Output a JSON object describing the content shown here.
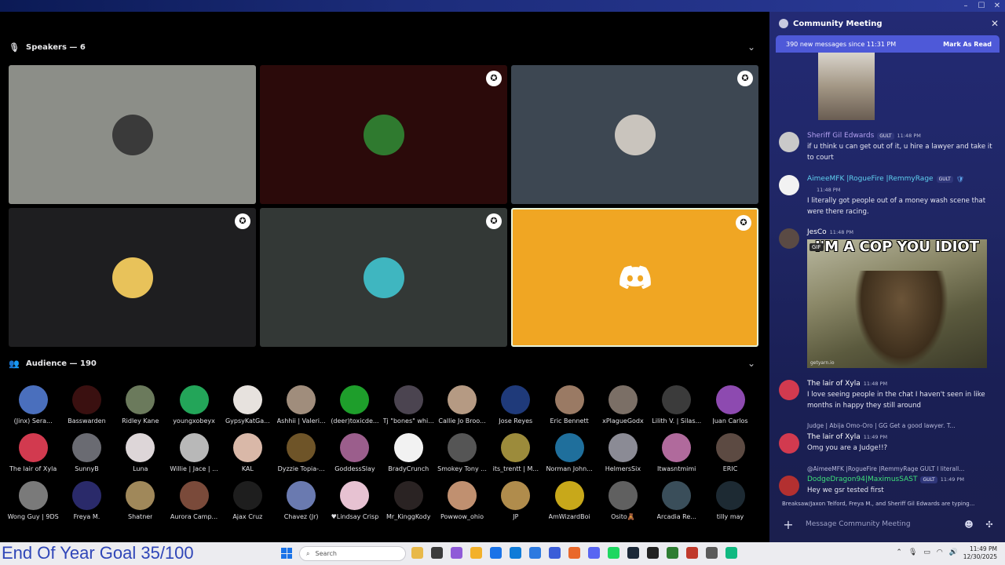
{
  "window": {
    "controls": [
      "–",
      "☐",
      "✕"
    ]
  },
  "stage": {
    "speakers_header": "Speakers — 6",
    "audience_header": "Audience — 190",
    "speakers": [
      {
        "name": "speaker-1",
        "bg": "#8c8e88",
        "avatar": "#3a3a3a",
        "moderator": false
      },
      {
        "name": "speaker-2",
        "bg": "#2b0a0a",
        "avatar": "#2f7a2f",
        "moderator": true
      },
      {
        "name": "speaker-3",
        "bg": "#3d4752",
        "avatar": "#c9c4bd",
        "moderator": true
      },
      {
        "name": "speaker-4",
        "bg": "#1e1e20",
        "avatar": "#e8c25a",
        "moderator": true
      },
      {
        "name": "speaker-5",
        "bg": "#333836",
        "avatar": "#3fb6c0",
        "moderator": true
      },
      {
        "name": "speaker-6",
        "bg": "#f0a623",
        "avatar": "",
        "moderator": true,
        "discord_logo": true
      }
    ],
    "audience": [
      [
        "(Jinx) Sera...",
        "Basswarden",
        "Ridley Kane",
        "youngxobeyx",
        "GypsyKatGa...",
        "Ashhii | Valeri...",
        "(deer)toxicde...",
        "Tj \"bones\" whi...",
        "Callie Jo Broo...",
        "Jose Reyes",
        "Eric Bennett",
        "xPlagueGodx",
        "Lilith V. | Silas...",
        "Juan Carlos"
      ],
      [
        "The lair of Xyla",
        "SunnyB",
        "Luna",
        "Willie | Jace | ...",
        "KAL",
        "Dyzzie Topia-...",
        "GoddessSlay",
        "BradyCrunch",
        "Smokey Tony ...",
        "its_trentt | M...",
        "Norman John...",
        "HelmersSix",
        "Itwasntmimi",
        "ERIC"
      ],
      [
        "Wong Guy | 9DS",
        "Freya M.",
        "Shatner",
        "Aurora Camp...",
        "Ajax Cruz",
        "Chavez (Jr)",
        "♥Lindsay Crisp",
        "Mr_KinggKody",
        "Powwow_ohio",
        "JP",
        "AmWizardBoi",
        "Osito🧸",
        "Arcadia Re...",
        "tilly may"
      ]
    ],
    "audience_colors": [
      [
        "#4a6fbd",
        "#3a1010",
        "#6b7a5c",
        "#23a559",
        "#e7e2de",
        "#a08d7c",
        "#1e9e2b",
        "#4b4450",
        "#b59a83",
        "#1f3a7a",
        "#9a7a64",
        "#7b6f66",
        "#3b3b3b",
        "#8d4ab0"
      ],
      [
        "#d23a4f",
        "#6a6b72",
        "#ddd6d8",
        "#b8b8b8",
        "#d9b8a8",
        "#6e5428",
        "#9b5e8c",
        "#f2f2f2",
        "#555555",
        "#9c8b3b",
        "#1f6f9c",
        "#8b8b95",
        "#b06a9c",
        "#5c4a42"
      ],
      [
        "#7a7a7a",
        "#2a2a6a",
        "#a0885a",
        "#7a4a3a",
        "#1e1e1e",
        "#6a7ab0",
        "#e7c2d2",
        "#2a2323",
        "#c09070",
        "#b08c4c",
        "#c8a81a",
        "#606060",
        "#3a4e5a",
        "#1d2a33"
      ]
    ]
  },
  "chat": {
    "title": "Community Meeting",
    "new_messages": "390 new messages since 11:31 PM",
    "mark_as_read": "Mark As Read",
    "messages": [
      {
        "author": "Sheriff Gil Edwards",
        "author_color": "#b2a0f0",
        "tag": "GULT",
        "time": "11:48 PM",
        "text": "if u think u can get out of it, u hire a lawyer and take it to court"
      },
      {
        "author": "AimeeMFK |RogueFire |RemmyRage",
        "author_color": "#5fd1f0",
        "tag": "GULT",
        "time": "11:48 PM",
        "text": "I literally got people out of a money wash scene that were there racing."
      },
      {
        "author": "JesCo",
        "author_color": "#ffffff",
        "tag": "",
        "time": "11:48 PM",
        "text": ""
      },
      {
        "author": "The lair of Xyla",
        "author_color": "#ffffff",
        "tag": "",
        "time": "11:48 PM",
        "text": "I love seeing people in the chat I haven't seen in like months in happy they still around"
      },
      {
        "author": "The lair of Xyla",
        "author_color": "#ffffff",
        "tag": "",
        "time": "11:49 PM",
        "text": "Omg you are a Judge!!?"
      },
      {
        "author": "DodgeDragon94|MaximusSAST",
        "author_color": "#3ee07a",
        "tag": "GULT",
        "time": "11:49 PM",
        "text": "Hey we gsr tested first"
      }
    ],
    "replies": [
      "Judge | Abija Omo-Oro | GG Get a good lawyer. T...",
      "@AimeeMFK |RogueFire |RemmyRage GULT I literall..."
    ],
    "gif": {
      "badge": "GIF",
      "caption": "I'M A COP YOU IDIOT",
      "watermark": "getyarn.io"
    },
    "typing": "Breaksaw/Jaxon Telford, Freya M., and Sheriff Gil Edwards are typing...",
    "composer_placeholder": "Message Community Meeting"
  },
  "taskbar": {
    "goal_text": "End Of Year Goal 35/100",
    "search_placeholder": "Search",
    "time": "11:49 PM",
    "date": "12/30/2025",
    "app_colors": [
      "#e8b94a",
      "#3b3b3b",
      "#8f5bd8",
      "#f3b12a",
      "#1a73e8",
      "#0f7bd8",
      "#2d7ae0",
      "#3b5dd8",
      "#e9682a",
      "#5865f2",
      "#1ed760",
      "#1b2838",
      "#222222",
      "#2e7d32",
      "#c0392b",
      "#5a5a5a",
      "#10b981"
    ]
  }
}
